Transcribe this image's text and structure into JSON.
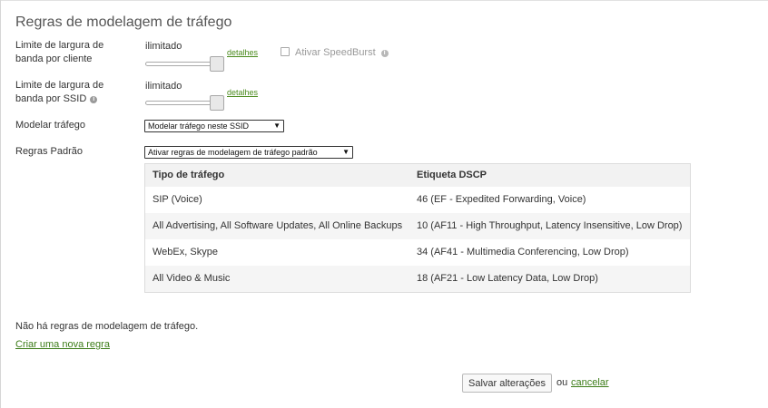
{
  "section": {
    "title": "Regras de modelagem de tráfego"
  },
  "client_bandwidth": {
    "label": "Limite de largura de banda por cliente",
    "value": "ilimitado",
    "details_link": "detalhes",
    "speedburst_label": "Ativar SpeedBurst",
    "speedburst_checked": false
  },
  "ssid_bandwidth": {
    "label": "Limite de largura de banda por SSID",
    "value": "ilimitado",
    "details_link": "detalhes"
  },
  "shape_traffic": {
    "label": "Modelar tráfego",
    "selected": "Modelar tráfego neste SSID"
  },
  "default_rules": {
    "label": "Regras Padrão",
    "selected": "Ativar regras de modelagem de tráfego padrão"
  },
  "table": {
    "headers": [
      "Tipo de tráfego",
      "Etiqueta DSCP"
    ],
    "rows": [
      [
        "SIP (Voice)",
        "46 (EF - Expedited Forwarding, Voice)"
      ],
      [
        "All Advertising, All Software Updates, All Online Backups",
        "10 (AF11 - High Throughput, Latency Insensitive, Low Drop)"
      ],
      [
        "WebEx, Skype",
        "34 (AF41 - Multimedia Conferencing, Low Drop)"
      ],
      [
        "All Video & Music",
        "18 (AF21 - Low Latency Data, Low Drop)"
      ]
    ]
  },
  "rules": {
    "empty_text": "Não há regras de modelagem de tráfego.",
    "create_link": "Criar uma nova regra"
  },
  "actions": {
    "save_label": "Salvar alterações",
    "or_text": "ou",
    "cancel_label": "cancelar"
  },
  "icons": {
    "info": "info-icon",
    "dropdown": "chevron-down-icon",
    "checkbox": "checkbox-icon"
  },
  "colors": {
    "link": "#3c7c18",
    "title": "#555555",
    "table_header_bg": "#f2f2f2"
  }
}
